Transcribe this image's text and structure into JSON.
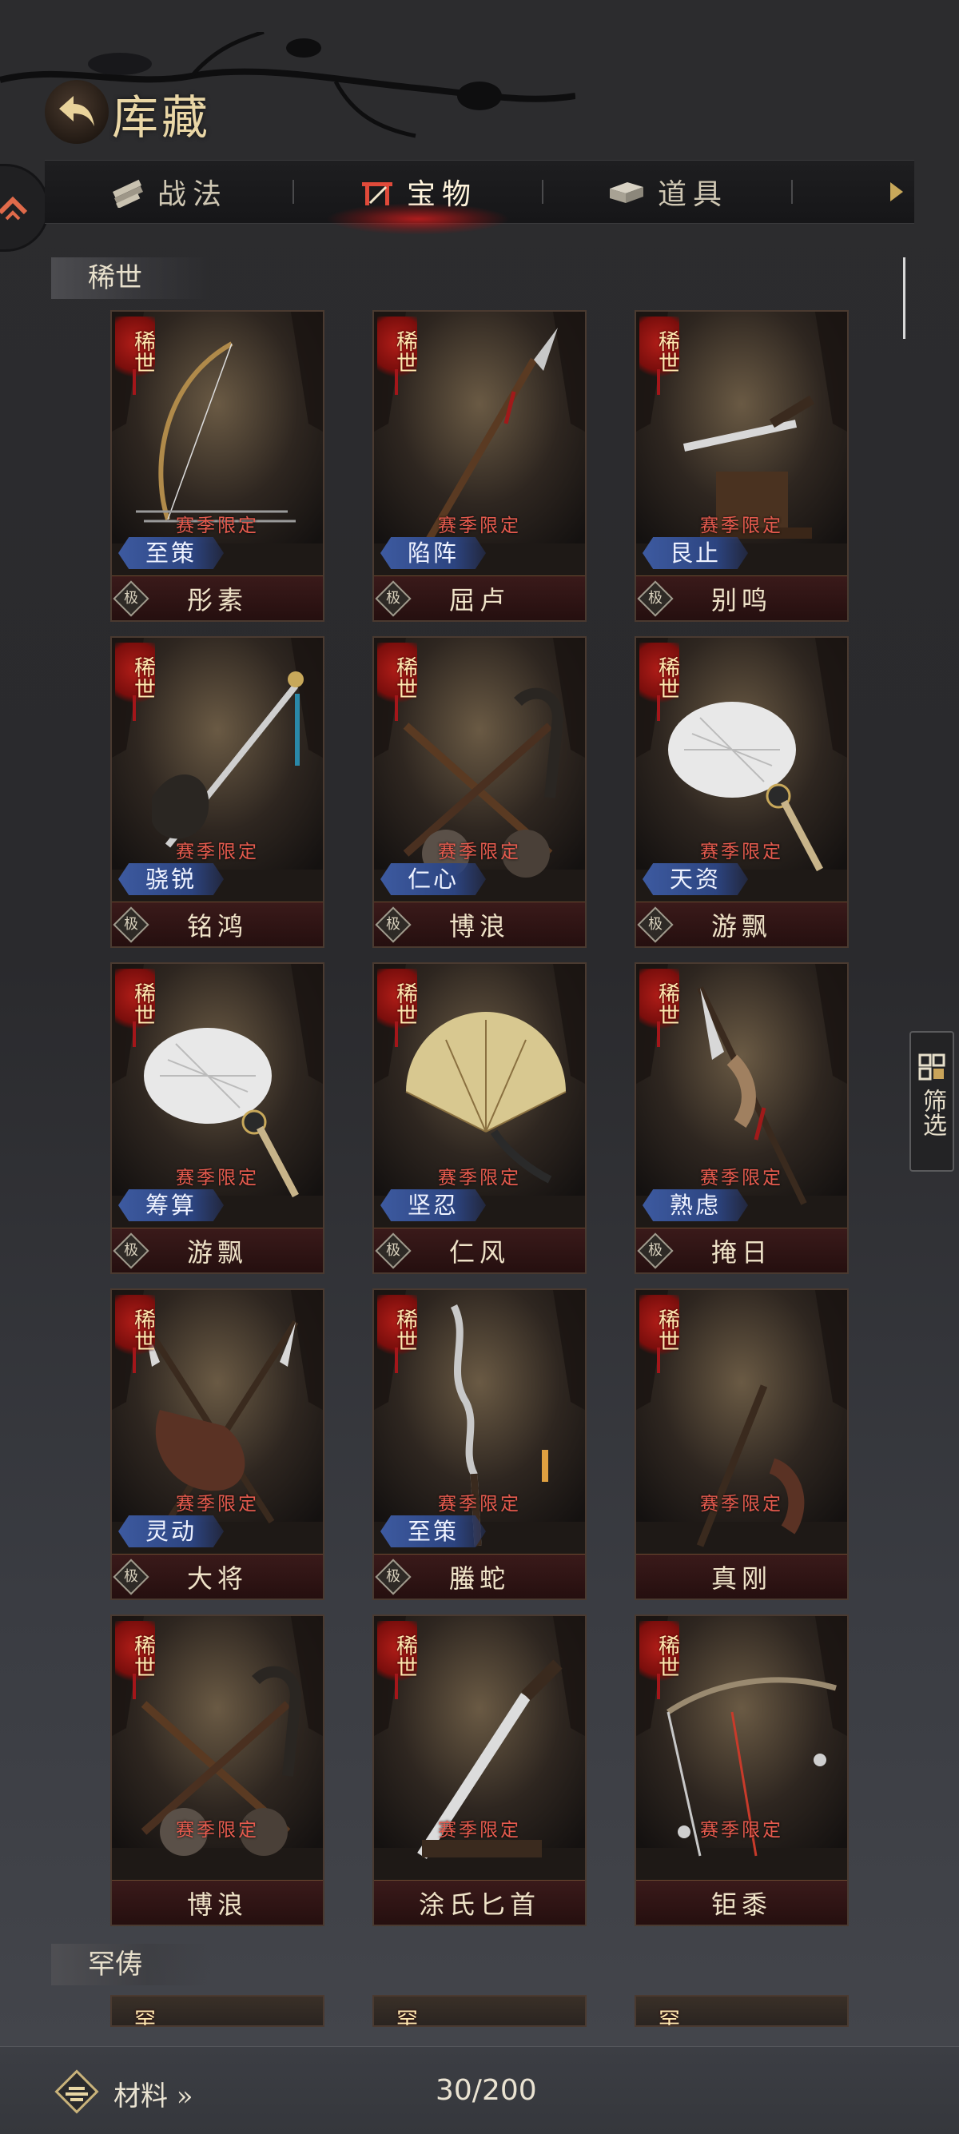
{
  "header": {
    "title": "库藏",
    "tabs": [
      {
        "label": "战法",
        "icon": "scroll-bundle-icon",
        "active": false
      },
      {
        "label": "宝物",
        "icon": "weapon-rack-icon",
        "active": true
      },
      {
        "label": "道具",
        "icon": "chest-icon",
        "active": false
      }
    ]
  },
  "sections": [
    {
      "label": "稀世"
    },
    {
      "label": "罕俦"
    }
  ],
  "rarity_label": "稀世",
  "season_label": "赛季限定",
  "grade_label": "极",
  "cards": [
    {
      "name": "彤素",
      "skill": "至策",
      "art": "bow",
      "grade": true
    },
    {
      "name": "屈卢",
      "skill": "陷阵",
      "art": "spear",
      "grade": true
    },
    {
      "name": "别鸣",
      "skill": "艮止",
      "art": "dagger-stand",
      "grade": true
    },
    {
      "name": "铭鸿",
      "skill": "骁锐",
      "art": "sword-dragon",
      "grade": true
    },
    {
      "name": "博浪",
      "skill": "仁心",
      "art": "hammers",
      "grade": true
    },
    {
      "name": "游飘",
      "skill": "天资",
      "art": "feather-fan",
      "grade": true
    },
    {
      "name": "游飘",
      "skill": "筹算",
      "art": "feather-fan",
      "grade": true
    },
    {
      "name": "仁风",
      "skill": "坚忍",
      "art": "folding-fan",
      "grade": true
    },
    {
      "name": "掩日",
      "skill": "熟虑",
      "art": "halberd",
      "grade": true
    },
    {
      "name": "大将",
      "skill": "灵动",
      "art": "crossed-halberds",
      "grade": true
    },
    {
      "name": "螣蛇",
      "skill": "至策",
      "art": "serpent-spear",
      "grade": true
    },
    {
      "name": "真刚",
      "skill": "",
      "art": "moon-axe",
      "grade": false
    },
    {
      "name": "博浪",
      "skill": "",
      "art": "hammers",
      "grade": false
    },
    {
      "name": "涂氏匕首",
      "skill": "",
      "art": "dagger",
      "grade": false
    },
    {
      "name": "钜黍",
      "skill": "",
      "art": "crossbow",
      "grade": false
    }
  ],
  "next_section_rarity": "罕",
  "filter": {
    "label": "筛选",
    "icon": "grid-icon"
  },
  "bottom": {
    "materials_label": "材料 »",
    "count": "30/200"
  }
}
